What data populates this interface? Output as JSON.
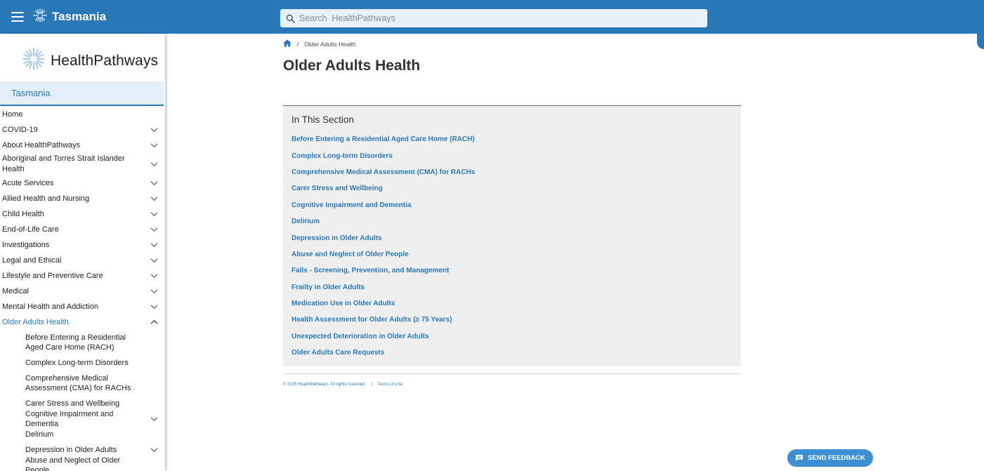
{
  "topbar": {
    "region": "Tasmania",
    "search_placeholder": "Search  HealthPathways"
  },
  "sidebar": {
    "logo_text": "HealthPathways",
    "region_label": "Tasmania",
    "items": [
      {
        "label": "Home",
        "expandable": false
      },
      {
        "label": "COVID-19",
        "expandable": true
      },
      {
        "label": "About HealthPathways",
        "expandable": true
      },
      {
        "label": "Aboriginal and Torres Strait Islander Health",
        "expandable": true
      },
      {
        "label": "Acute Services",
        "expandable": true
      },
      {
        "label": "Allied Health and Nursing",
        "expandable": true
      },
      {
        "label": "Child Health",
        "expandable": true
      },
      {
        "label": "End-of-Life Care",
        "expandable": true
      },
      {
        "label": "Investigations",
        "expandable": true
      },
      {
        "label": "Legal and Ethical",
        "expandable": true
      },
      {
        "label": "Lifestyle and Preventive Care",
        "expandable": true
      },
      {
        "label": "Medical",
        "expandable": true
      },
      {
        "label": "Mental Health and Addiction",
        "expandable": true
      },
      {
        "label": "Older Adults Health",
        "expandable": true,
        "expanded": true,
        "active": true
      }
    ],
    "sub_items": [
      {
        "label": "Before Entering a Residential Aged Care Home (RACH)",
        "expandable": false
      },
      {
        "label": "Complex Long-term Disorders",
        "expandable": false
      },
      {
        "label": "Comprehensive Medical Assessment (CMA) for RACHs",
        "expandable": false
      },
      {
        "label": "Carer Stress and Wellbeing",
        "expandable": false
      },
      {
        "label": "Cognitive Impairment and Dementia",
        "expandable": true
      },
      {
        "label": "Delirium",
        "expandable": false
      },
      {
        "label": "Depression in Older Adults",
        "expandable": true
      },
      {
        "label": "Abuse and Neglect of Older People",
        "expandable": false
      }
    ]
  },
  "breadcrumb": {
    "home_icon": "home-icon",
    "separator": "/",
    "current": "Older Adults Health"
  },
  "page": {
    "title": "Older Adults Health",
    "section_heading": "In This Section",
    "links": [
      "Before Entering a Residential Aged Care Home (RACH)",
      "Complex Long-term Disorders",
      "Comprehensive Medical Assessment (CMA) for RACHs",
      "Carer Stress and Wellbeing",
      "Cognitive Impairment and Dementia",
      "Delirium",
      "Depression in Older Adults",
      "Abuse and Neglect of Older People",
      "Falls - Screening, Prevention, and Management",
      "Frailty in Older Adults",
      "Medication Use in Older Adults",
      "Health Assessment for Older Adults (≥ 75 Years)",
      "Unexpected Deterioration in Older Adults",
      "Older Adults Care Requests"
    ]
  },
  "footer": {
    "copyright": "© 2025 HealthPathways. All rights reserved.",
    "separator": "|",
    "terms": "Terms of Use"
  },
  "feedback": {
    "label": "SEND FEEDBACK",
    "icon": "feedback-icon"
  },
  "colors": {
    "brand": "#2a78b8",
    "link": "#2a78b8",
    "section_bg": "#efefef",
    "feedback_bg": "#3c8fd1"
  }
}
